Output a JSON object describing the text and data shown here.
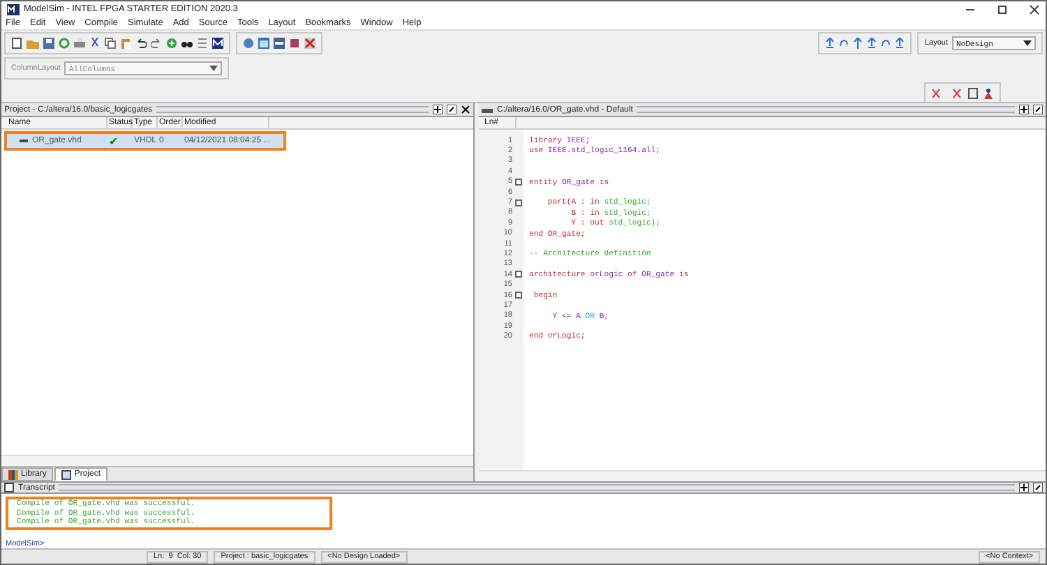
{
  "window": {
    "title": "ModelSim - INTEL FPGA STARTER EDITION 2020.3"
  },
  "menu": [
    "File",
    "Edit",
    "View",
    "Compile",
    "Simulate",
    "Add",
    "Source",
    "Tools",
    "Layout",
    "Bookmarks",
    "Window",
    "Help"
  ],
  "column_layout": {
    "label": "ColumnLayout",
    "value": "AllColumns"
  },
  "layout": {
    "label": "Layout",
    "value": "NoDesign"
  },
  "project": {
    "title": "Project - C:/altera/16.0/basic_logicgates",
    "columns": [
      "Name",
      "Status",
      "Type",
      "Order",
      "Modified"
    ],
    "rows": [
      {
        "name": "OR_gate.vhd",
        "status": "✔",
        "type": "VHDL",
        "order": "0",
        "modified": "04/12/2021 08:04:25 ...",
        "selected": true,
        "highlighted": true
      }
    ]
  },
  "tabs": [
    {
      "label": "Library",
      "selected": false
    },
    {
      "label": "Project",
      "selected": true
    }
  ],
  "editor": {
    "title": "C:/altera/16.0/OR_gate.vhd - Default",
    "gutter_header": "Ln#",
    "lines": [
      {
        "n": "1",
        "fold": false,
        "tokens": [
          {
            "kind": "kw",
            "text": "library"
          },
          {
            "kind": "id",
            "text": " IEEE;"
          }
        ]
      },
      {
        "n": "2",
        "fold": false,
        "tokens": [
          {
            "kind": "kw",
            "text": "use"
          },
          {
            "kind": "id",
            "text": " IEEE.std_logic_1164.all;"
          }
        ]
      },
      {
        "n": "3",
        "fold": false
      },
      {
        "n": "4",
        "fold": false
      },
      {
        "n": "5",
        "fold": true,
        "tokens": [
          {
            "kind": "kw",
            "text": "entity"
          },
          {
            "kind": "id",
            "text": " OR_gate"
          },
          {
            "kind": "kw",
            "text": " is"
          }
        ]
      },
      {
        "n": "6",
        "fold": false
      },
      {
        "n": "7",
        "fold": true,
        "tokens": [
          {
            "kind": "kw",
            "text": "    port(A : in "
          },
          {
            "kind": "type",
            "text": "std_logic;"
          }
        ]
      },
      {
        "n": "8",
        "fold": false,
        "tokens": [
          {
            "kind": "kw",
            "text": "         B : in "
          },
          {
            "kind": "type",
            "text": "std_logic;"
          }
        ]
      },
      {
        "n": "9",
        "fold": false,
        "tokens": [
          {
            "kind": "kw",
            "text": "         Y : out "
          },
          {
            "kind": "type",
            "text": "std_logic);"
          }
        ]
      },
      {
        "n": "10",
        "fold": false,
        "tokens": [
          {
            "kind": "kw",
            "text": "end OR_gate;"
          }
        ]
      },
      {
        "n": "11",
        "fold": false
      },
      {
        "n": "12",
        "fold": false,
        "tokens": [
          {
            "kind": "comment",
            "text": "-- Architecture definition"
          }
        ]
      },
      {
        "n": "13",
        "fold": false
      },
      {
        "n": "14",
        "fold": true,
        "tokens": [
          {
            "kind": "kw",
            "text": "architecture"
          },
          {
            "kind": "id",
            "text": " orLogic"
          },
          {
            "kind": "kw",
            "text": " of"
          },
          {
            "kind": "id",
            "text": " OR_gate"
          },
          {
            "kind": "kw",
            "text": " is"
          }
        ]
      },
      {
        "n": "15",
        "fold": false
      },
      {
        "n": "16",
        "fold": true,
        "tokens": [
          {
            "kind": "kw",
            "text": " begin"
          }
        ]
      },
      {
        "n": "17",
        "fold": false
      },
      {
        "n": "18",
        "fold": false,
        "tokens": [
          {
            "kind": "id",
            "text": "     Y <= A "
          },
          {
            "kind": "op",
            "text": "OR"
          },
          {
            "kind": "id",
            "text": " B;"
          }
        ]
      },
      {
        "n": "19",
        "fold": false
      },
      {
        "n": "20",
        "fold": false,
        "tokens": [
          {
            "kind": "kw",
            "text": "end orLogic;"
          }
        ]
      }
    ]
  },
  "transcript": {
    "title": "Transcript",
    "highlighted": true,
    "lines": [
      "Compile of OR_gate.vhd was successful.",
      "Compile of OR_gate.vhd was successful.",
      "Compile of OR_gate.vhd was successful."
    ],
    "prompt": "ModelSim>"
  },
  "status_bar": [
    "Ln:  9  Col: 30",
    "Project : basic_logicgates",
    "<No Design Loaded>",
    "<No Context>"
  ]
}
